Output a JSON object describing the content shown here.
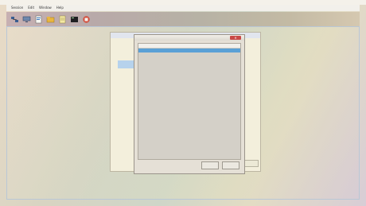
{
  "menubar": {
    "items": [
      "Session",
      "Edit",
      "Window",
      "Help"
    ]
  },
  "toolbar": {
    "buttons": [
      {
        "name": "network-icon"
      },
      {
        "name": "computer-icon"
      },
      {
        "name": "document-icon"
      },
      {
        "name": "folder-icon"
      },
      {
        "name": "notes-icon"
      },
      {
        "name": "terminal-icon"
      },
      {
        "name": "stop-icon"
      }
    ]
  },
  "background_dialog": {
    "title": "",
    "text": "",
    "button_label": ""
  },
  "dialog": {
    "title": "",
    "close_label": "✕",
    "rows": [
      {
        "col1": "",
        "col2": "",
        "col3": ""
      },
      {
        "col1": "",
        "col2": "",
        "col3": ""
      }
    ],
    "status": "",
    "ok_label": "",
    "cancel_label": ""
  },
  "colors": {
    "selection": "#5aa0d6",
    "close": "#c94a47"
  }
}
